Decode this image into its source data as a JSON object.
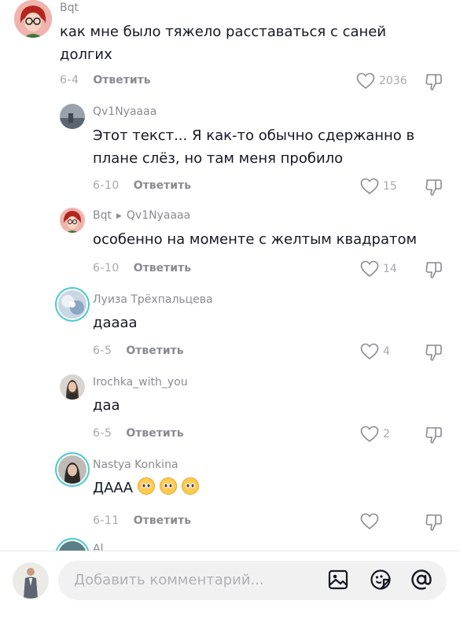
{
  "comments": [
    {
      "author": "Bqt",
      "text": "как мне было тяжело расставаться с саней долгих",
      "date": "6-4",
      "reply_label": "Ответить",
      "likes": "2036"
    },
    {
      "author": "Qv1Nyaaaa",
      "text": "Этот текст... Я как-то обычно сдержанно в плане слёз, но там меня пробило",
      "date": "6-10",
      "reply_label": "Ответить",
      "likes": "15"
    },
    {
      "author": "Bqt",
      "reply_to": "Qv1Nyaaaa",
      "text": "особенно на моменте с желтым квадратом",
      "date": "6-10",
      "reply_label": "Ответить",
      "likes": "14"
    },
    {
      "author": "Луиза Трёхпальцева",
      "text": "даааа",
      "date": "6-5",
      "reply_label": "Ответить",
      "likes": "4"
    },
    {
      "author": "Irochka_with_you",
      "text": "даа",
      "date": "6-5",
      "reply_label": "Ответить",
      "likes": "2"
    },
    {
      "author": "Nastya Konkina",
      "text": "ДААА",
      "date": "6-11",
      "reply_label": "Ответить",
      "likes": ""
    },
    {
      "author": "Al..."
    }
  ],
  "composer": {
    "placeholder": "Добавить комментарий..."
  },
  "icons": {
    "like": "heart-outline-icon",
    "dislike": "thumbs-down-outline-icon",
    "emoji": "pleading-face-emoji",
    "image": "image-icon",
    "sticker": "emoji-sticker-icon",
    "mention": "at-icon"
  },
  "colors": {
    "text": "#161823",
    "secondary": "#8a8b91",
    "muted": "#a7a8ad",
    "ring": "#4cc9c9",
    "input_bg": "#f1f1f2"
  }
}
